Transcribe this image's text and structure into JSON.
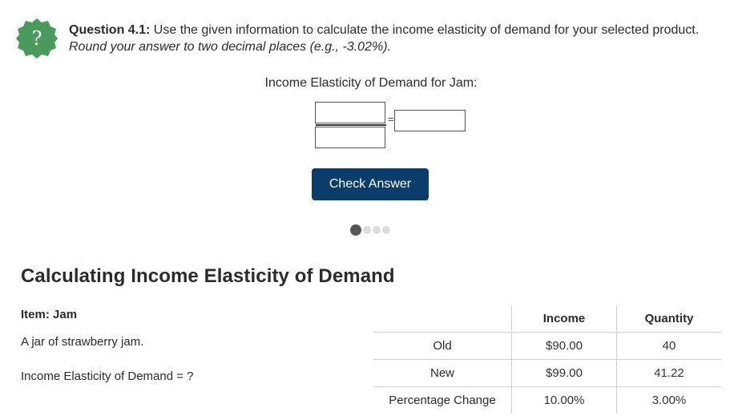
{
  "question": {
    "icon": "question-mark-badge-icon",
    "icon_color": "#4a9a5b",
    "label": "Question 4.1:",
    "text": " Use the given information to calculate the income elasticity of demand for your selected product. ",
    "instruction": "Round your answer to two decimal places (e.g., -3.02%)."
  },
  "elasticity": {
    "label": "Income Elasticity of Demand for Jam:",
    "numerator_value": "",
    "denominator_value": "",
    "result_value": "",
    "equals_sign": "="
  },
  "check_button": {
    "label": "Check Answer",
    "color": "#0b3d6b"
  },
  "progress": {
    "total": 4,
    "current": 1
  },
  "section": {
    "heading": "Calculating Income Elasticity of Demand",
    "item_title": "Item: Jam",
    "item_description": "A jar of strawberry jam.",
    "elasticity_line": "Income Elasticity of Demand = ?"
  },
  "table": {
    "columns": [
      "",
      "Income",
      "Quantity"
    ],
    "rows": [
      {
        "label": "Old",
        "income": "$90.00",
        "quantity": "40"
      },
      {
        "label": "New",
        "income": "$99.00",
        "quantity": "41.22"
      },
      {
        "label": "Percentage Change",
        "income": "10.00%",
        "quantity": "3.00%"
      }
    ]
  }
}
